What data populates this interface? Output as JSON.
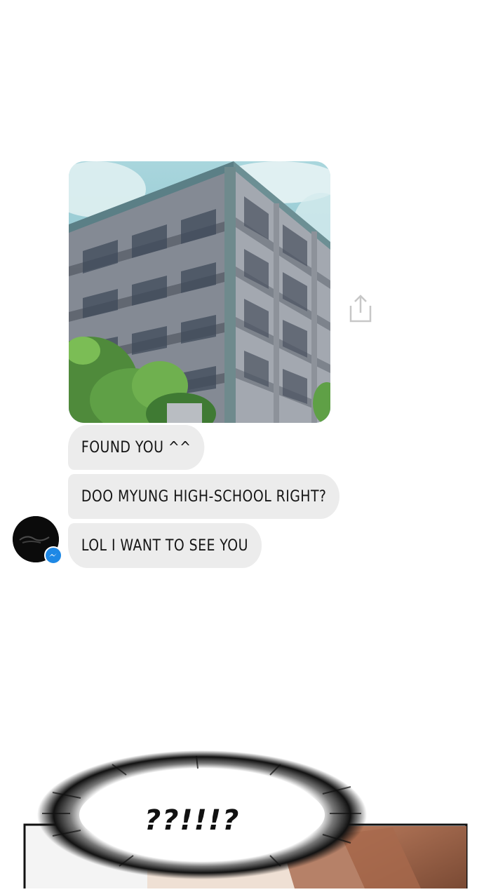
{
  "message": {
    "image": {
      "subject": "school building"
    },
    "share_icon": "share-icon",
    "bubbles": [
      {
        "text": "FOUND YOU ^^"
      },
      {
        "text": "DOO MYUNG HIGH-SCHOOL RIGHT?"
      },
      {
        "text": "LOL I WANT TO SEE YOU"
      }
    ],
    "sender": {
      "avatar_icon": "profile-avatar",
      "badge_icon": "messenger-icon",
      "badge_color": "#1e88e5"
    }
  },
  "panel": {
    "reaction_text": "??!!!?"
  },
  "colors": {
    "bubble": "#ececec",
    "background": "#ffffff",
    "sky": "#8cc6cf",
    "building": "#8e939c"
  }
}
